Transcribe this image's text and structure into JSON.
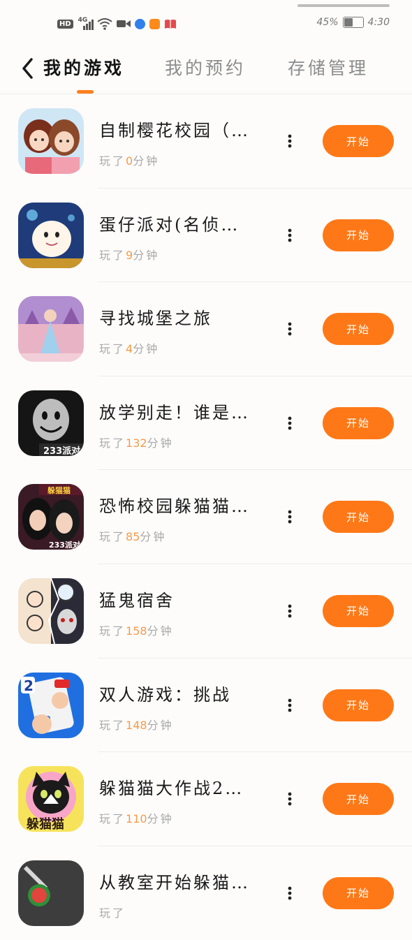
{
  "status": {
    "hd": "HD",
    "network": "4G",
    "battery_percent_text": "45%",
    "battery_level": 0.45,
    "time": "4:30"
  },
  "nav": {
    "tabs": [
      {
        "label": "我的游戏",
        "active": true
      },
      {
        "label": "我的预约",
        "active": false
      },
      {
        "label": "存储管理",
        "active": false
      }
    ]
  },
  "games": [
    {
      "title": "自制樱花校园（…",
      "played_prefix": "玩了",
      "minutes": "0",
      "unit": "分钟",
      "button": "开始",
      "icon": "anime-girls-icon"
    },
    {
      "title": "蛋仔派对(名侦…",
      "played_prefix": "玩了",
      "minutes": "9",
      "unit": "分钟",
      "button": "开始",
      "icon": "eggy-character-icon"
    },
    {
      "title": "寻找城堡之旅",
      "played_prefix": "玩了",
      "minutes": "4",
      "unit": "分钟",
      "button": "开始",
      "icon": "princess-castle-icon"
    },
    {
      "title": "放学别走！谁是…",
      "played_prefix": "玩了",
      "minutes": "132",
      "unit": "分钟",
      "button": "开始",
      "icon": "smiling-mask-icon"
    },
    {
      "title": "恐怖校园躲猫猫…",
      "played_prefix": "玩了",
      "minutes": "85",
      "unit": "分钟",
      "button": "开始",
      "icon": "school-girls-hide-icon"
    },
    {
      "title": "猛鬼宿舍",
      "played_prefix": "玩了",
      "minutes": "158",
      "unit": "分钟",
      "button": "开始",
      "icon": "ghost-dorm-icon"
    },
    {
      "title": "双人游戏：挑战",
      "played_prefix": "玩了",
      "minutes": "148",
      "unit": "分钟",
      "button": "开始",
      "icon": "two-player-cars-icon"
    },
    {
      "title": "躲猫猫大作战2…",
      "played_prefix": "玩了",
      "minutes": "110",
      "unit": "分钟",
      "button": "开始",
      "icon": "black-cat-icon"
    },
    {
      "title": "从教室开始躲猫…",
      "played_prefix": "玩了",
      "minutes": "",
      "unit": "",
      "button": "开始",
      "icon": "watermelon-knife-icon"
    }
  ],
  "icon_labels": {
    "badge_233": "233派对",
    "hide_seek": "躲猫猫",
    "two": "2"
  },
  "colors": {
    "accent": "#ff7817",
    "minutes": "#f59a4a"
  }
}
